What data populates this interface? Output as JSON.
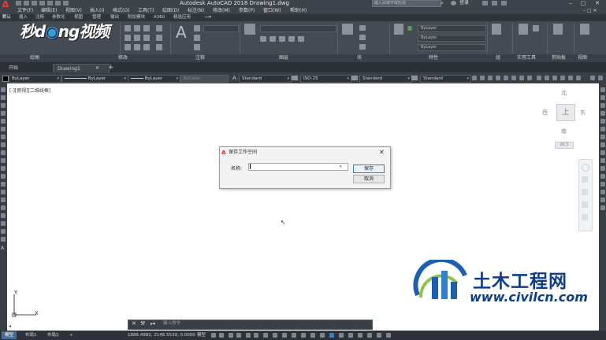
{
  "window": {
    "title": "Autodesk AutoCAD 2018    Drawing1.dwg",
    "search_placeholder": "键入关键字或短语",
    "user": "登录"
  },
  "menu": [
    "文件(F)",
    "编辑(E)",
    "视图(V)",
    "插入(I)",
    "格式(O)",
    "工具(T)",
    "绘图(D)",
    "标注(N)",
    "修改(M)",
    "参数(P)",
    "窗口(W)",
    "帮助(H)"
  ],
  "ribbon_tabs": [
    "默认",
    "插入",
    "注释",
    "参数化",
    "视图",
    "管理",
    "输出",
    "附加模块",
    "A360",
    "精选应用"
  ],
  "ribbon_groups": [
    "绘图",
    "修改",
    "注释",
    "图层",
    "块",
    "特性",
    "组",
    "实用工具",
    "剪贴板",
    "视图"
  ],
  "ribbon_props": [
    "ByLayer",
    "ByLayer",
    "ByLayer"
  ],
  "file_tabs": [
    "开始",
    "Drawing1"
  ],
  "properties_bar": {
    "layer_color": "ByLayer",
    "linetype": "ByLayer",
    "lineweight": "ByLayer",
    "plot_style": "ByColor",
    "text_style": "Standard",
    "dim_style": "ISO-25",
    "table_style": "Standard",
    "multileader_style": "Standard"
  },
  "viewport_label": "[-][俯视][二维线框]",
  "viewcube": {
    "north": "北",
    "south": "南",
    "east": "东",
    "west": "西",
    "face": "上",
    "wcs": "WCS"
  },
  "dialog": {
    "title": "保存工作空间",
    "name_label": "名称:",
    "name_value": "",
    "save_label": "保存",
    "cancel_label": "取消"
  },
  "ucs": {
    "x": "X",
    "y": "Y"
  },
  "command": {
    "placeholder": "键入命令"
  },
  "layout_tabs": [
    "模型",
    "布局1",
    "布局2"
  ],
  "status": {
    "coordinates": "1886.4982, 2146.5539, 0.0000",
    "model": "模型"
  },
  "watermark": {
    "text": "土木工程网",
    "url": "www.civilcn.com"
  },
  "logo": {
    "text_1": "秒",
    "text_2": "d",
    "text_3": "ng",
    "text_4": "视频"
  },
  "colors": {
    "accent": "#2fa0e6",
    "watermark": "#0d3e8c",
    "autocad_red": "#e23a2a"
  }
}
